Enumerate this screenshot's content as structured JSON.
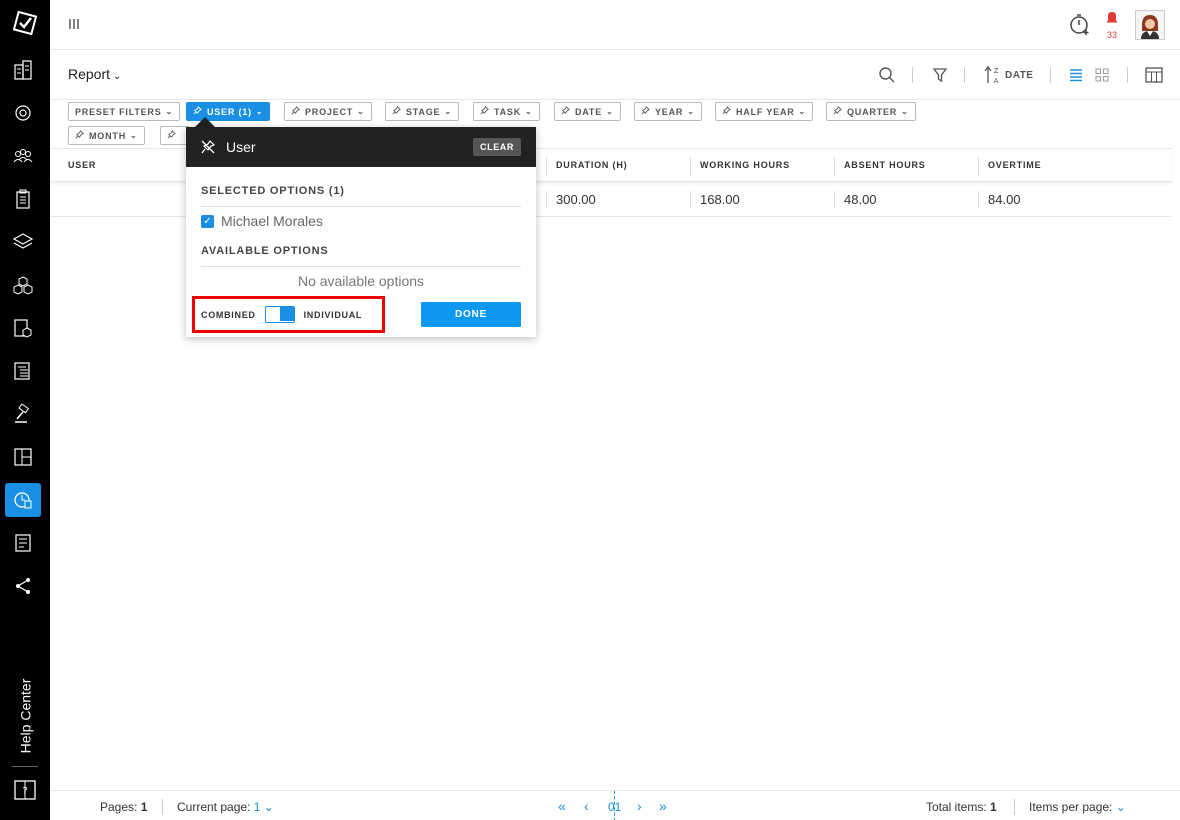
{
  "sidebar": {
    "help_center_label": "Help Center",
    "icons": [
      "buildings-icon",
      "settings-building-icon",
      "people-icon",
      "clipboard-icon",
      "layers-icon",
      "cubes-icon",
      "document-cube-icon",
      "sitemap-document-icon",
      "gavel-icon",
      "layout-icon",
      "time-report-icon",
      "ledger-icon",
      "share-icon"
    ],
    "active_icon": "time-report-icon"
  },
  "topbar": {
    "notification_count": "33"
  },
  "toolbar": {
    "report_label": "Report",
    "sort_label": "DATE"
  },
  "filters": [
    {
      "label": "PRESET FILTERS",
      "has_pin": false,
      "active": false
    },
    {
      "label": "USER (1)",
      "has_pin": true,
      "active": true
    },
    {
      "label": "PROJECT",
      "has_pin": true,
      "active": false
    },
    {
      "label": "STAGE",
      "has_pin": true,
      "active": false
    },
    {
      "label": "TASK",
      "has_pin": true,
      "active": false
    },
    {
      "label": "DATE",
      "has_pin": true,
      "active": false
    },
    {
      "label": "YEAR",
      "has_pin": true,
      "active": false
    },
    {
      "label": "HALF YEAR",
      "has_pin": true,
      "active": false
    },
    {
      "label": "QUARTER",
      "has_pin": true,
      "active": false
    },
    {
      "label": "MONTH",
      "has_pin": true,
      "active": false
    }
  ],
  "table": {
    "columns": [
      "USER",
      "DURATION (H)",
      "WORKING HOURS",
      "ABSENT HOURS",
      "OVERTIME"
    ],
    "rows": [
      {
        "duration": "300.00",
        "working": "168.00",
        "absent": "48.00",
        "overtime": "84.00"
      }
    ]
  },
  "popup": {
    "title": "User",
    "clear_label": "CLEAR",
    "selected_title": "SELECTED OPTIONS (1)",
    "selected_options": [
      "Michael Morales"
    ],
    "available_title": "AVAILABLE OPTIONS",
    "no_options_text": "No available options",
    "combined_label": "COMBINED",
    "individual_label": "INDIVIDUAL",
    "done_label": "DONE",
    "toggle_state": "individual"
  },
  "footer": {
    "pages_label": "Pages:",
    "pages_value": "1",
    "current_page_label": "Current page:",
    "current_page_value": "1",
    "page_indicator": "01",
    "total_items_label": "Total items:",
    "total_items_value": "1",
    "items_per_page_label": "Items per page:"
  },
  "colors": {
    "accent": "#1a8fe3",
    "sidebar_bg": "#000000",
    "highlight_border": "#e00000",
    "notification": "#e53935"
  }
}
